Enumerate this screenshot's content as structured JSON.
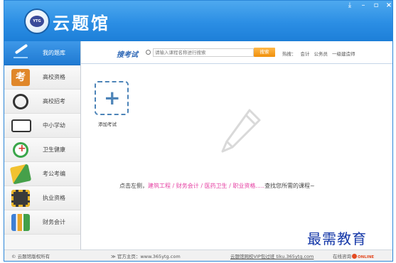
{
  "header": {
    "app_title": "云题馆",
    "logo_text": "YTG"
  },
  "sidebar": {
    "items": [
      {
        "label": "我的题库",
        "icon": "pen-icon",
        "active": true
      },
      {
        "label": "高校资格",
        "icon": "kao-icon",
        "active": false
      },
      {
        "label": "高校招考",
        "icon": "ring-icon",
        "active": false
      },
      {
        "label": "中小学幼",
        "icon": "book-icon",
        "active": false
      },
      {
        "label": "卫生健康",
        "icon": "medical-cross-icon",
        "active": false
      },
      {
        "label": "考公考编",
        "icon": "books-icon",
        "active": false
      },
      {
        "label": "执业资格",
        "icon": "film-icon",
        "active": false
      },
      {
        "label": "财务会计",
        "icon": "chart-icon",
        "active": false
      }
    ]
  },
  "search": {
    "title": "搜考试",
    "placeholder": "请输入课程名称进行搜索",
    "button_label": "搜索",
    "hot_label": "热搜：",
    "hot_terms": [
      "会计",
      "公务员",
      "一级建造师"
    ]
  },
  "main": {
    "add_label": "添加考试",
    "hint_prefix": "点击左侧，",
    "hint_cat1": "建筑工程",
    "hint_sep": " / ",
    "hint_cat2": "财务会计",
    "hint_cat3": "医药卫生",
    "hint_cat4": "职业资格",
    "hint_ellipsis": ".....",
    "hint_suffix": "查找您所需的课程~"
  },
  "footer": {
    "copyright": "© 云题馆版权所有",
    "site": "≫ 官方主页：www.365ytg.com",
    "vip": "云题馆网校VIP包过班 tiku.365ytg.com",
    "consult": "在线咨询",
    "online_badge": "ONLINE"
  },
  "watermark": "最需教育",
  "colors": {
    "header_blue": "#2b8ee4",
    "active_blue": "#1f7ad2",
    "highlight_pink": "#e53fa2",
    "search_orange": "#f08f0a"
  }
}
